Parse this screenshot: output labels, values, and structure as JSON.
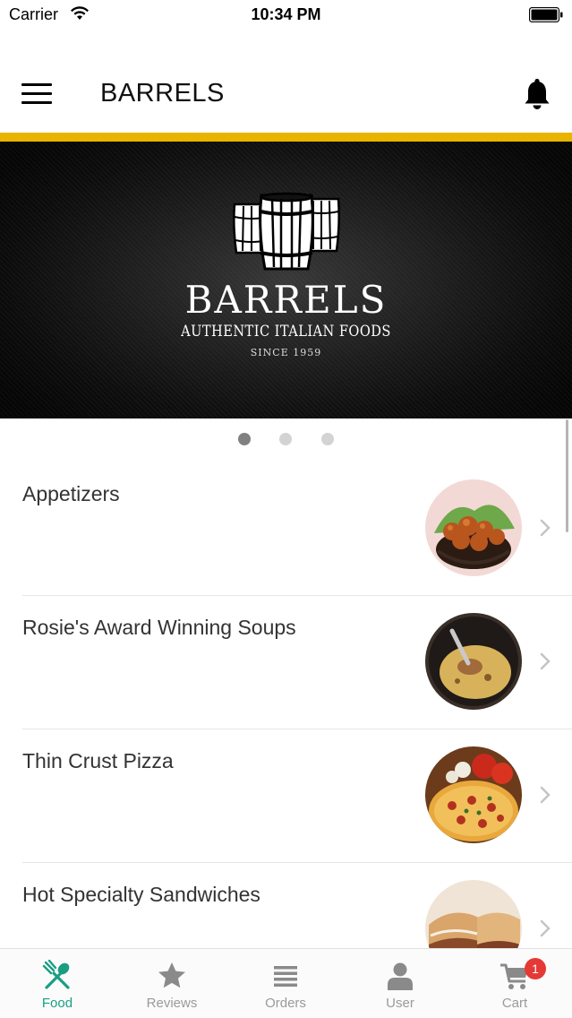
{
  "status_bar": {
    "carrier": "Carrier",
    "time": "10:34 PM"
  },
  "header": {
    "title": "BARRELS",
    "menu_icon": "hamburger-menu-icon",
    "notification_icon": "bell-icon"
  },
  "carousel": {
    "brand_name": "BARRELS",
    "tagline": "AUTHENTIC ITALIAN FOODS",
    "since": "SINCE 1959",
    "slide_count": 3,
    "active_slide": 0
  },
  "categories": [
    {
      "name": "Appetizers",
      "image": "fried-appetizers-basket"
    },
    {
      "name": "Rosie's Award Winning Soups",
      "image": "soup-bowl"
    },
    {
      "name": "Thin Crust Pizza",
      "image": "pizza"
    },
    {
      "name": "Hot Specialty Sandwiches",
      "image": "sandwiches"
    }
  ],
  "tabs": [
    {
      "label": "Food",
      "icon": "fork-spoon-icon",
      "active": true
    },
    {
      "label": "Reviews",
      "icon": "star-icon",
      "active": false
    },
    {
      "label": "Orders",
      "icon": "list-icon",
      "active": false
    },
    {
      "label": "User",
      "icon": "user-icon",
      "active": false
    },
    {
      "label": "Cart",
      "icon": "cart-icon",
      "active": false,
      "badge": "1"
    }
  ],
  "colors": {
    "accent_bar": "#e8b400",
    "tab_active": "#1a9e82",
    "tab_inactive": "#9a9a9a",
    "badge": "#e53935"
  }
}
